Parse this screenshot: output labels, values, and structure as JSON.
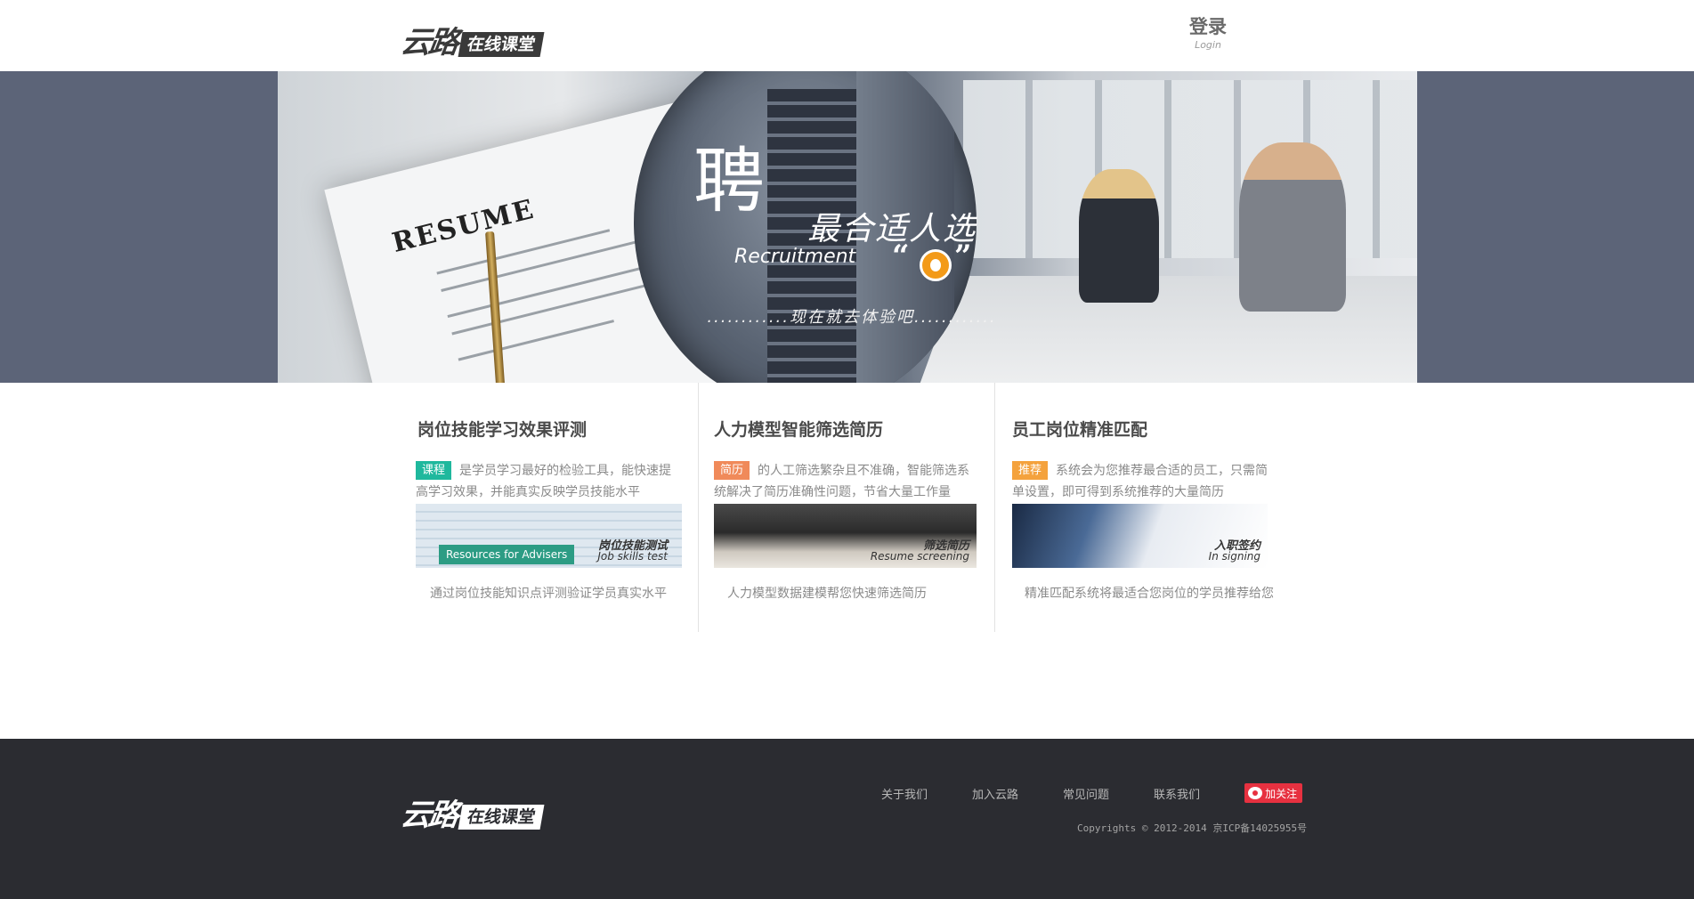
{
  "header": {
    "logo_main": "云路",
    "logo_tag": "在线课堂",
    "login_label": "登录",
    "login_sub": "Login"
  },
  "banner": {
    "hero_char": "聘",
    "slogan": "最合适人选",
    "recruitment": "Recruitment",
    "quote_open": "“",
    "quote_close": "”",
    "resume_text": "RESUME",
    "cta": "............现在就去体验吧............"
  },
  "features": [
    {
      "title": "岗位技能学习效果评测",
      "badge": "课程",
      "badge_color": "#1fb89d",
      "desc": "是学员学习最好的检验工具，能快速提高学习效果，并能真实反映学员技能水平",
      "thumb_cn": "岗位技能测试",
      "thumb_en": "Job skills test",
      "thumb_extra": "Resources for Advisers",
      "footer": "通过岗位技能知识点评测验证学员真实水平"
    },
    {
      "title": "人力模型智能筛选简历",
      "badge": "简历",
      "badge_color": "#f08a5a",
      "desc": "的人工筛选繁杂且不准确，智能筛选系统解决了简历准确性问题，节省大量工作量",
      "thumb_cn": "筛选简历",
      "thumb_en": "Resume screening",
      "footer": "人力模型数据建模帮您快速筛选简历"
    },
    {
      "title": "员工岗位精准匹配",
      "badge": "推荐",
      "badge_color": "#f4a23d",
      "desc": "系统会为您推荐最合适的员工，只需简单设置，即可得到系统推荐的大量简历",
      "thumb_cn": "入职签约",
      "thumb_en": "In signing",
      "footer": "精准匹配系统将最适合您岗位的学员推荐给您"
    }
  ],
  "footer": {
    "logo_main": "云路",
    "logo_tag": "在线课堂",
    "links": [
      "关于我们",
      "加入云路",
      "常见问题",
      "联系我们"
    ],
    "weibo_label": "加关注",
    "copyright": "Copyrights © 2012-2014 京ICP备14025955号"
  },
  "colors": {
    "banner_side": "#5c6478",
    "footer_bg": "#2b2c31",
    "accent_orange": "#f39a18",
    "weibo_red": "#e73140"
  }
}
